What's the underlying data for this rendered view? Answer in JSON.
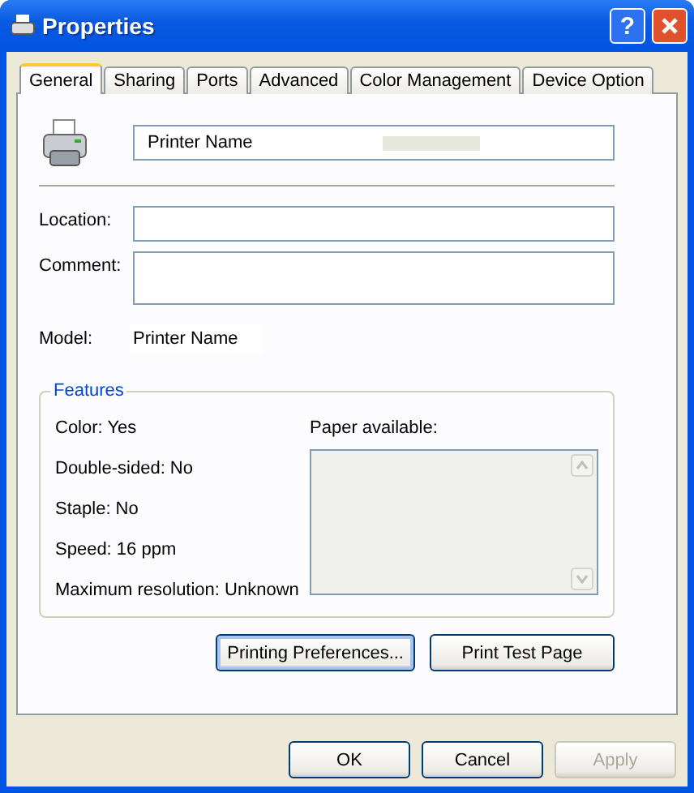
{
  "window": {
    "title": "Properties",
    "help_button": "?"
  },
  "tabs": [
    {
      "label": "General",
      "selected": true
    },
    {
      "label": "Sharing",
      "selected": false
    },
    {
      "label": "Ports",
      "selected": false
    },
    {
      "label": "Advanced",
      "selected": false
    },
    {
      "label": "Color Management",
      "selected": false
    },
    {
      "label": "Device Option",
      "selected": false
    }
  ],
  "printer_name": {
    "value": "Printer Name"
  },
  "fields": [
    {
      "label": "Location:",
      "multiline": false
    },
    {
      "label": "Comment:",
      "multiline": true
    }
  ],
  "model": {
    "label": "Model:",
    "value": "Printer Name"
  },
  "features": {
    "title": "Features",
    "items": [
      "Color: Yes",
      "Double-sided: No",
      "Staple: No",
      "Speed: 16 ppm",
      "Maximum resolution: Unknown"
    ],
    "paper_label": "Paper available:"
  },
  "panel_buttons": [
    {
      "label": "Printing Preferences...",
      "focused": true
    },
    {
      "label": "Print Test Page",
      "focused": false
    }
  ],
  "dialog_buttons": [
    {
      "label": "OK",
      "disabled": false
    },
    {
      "label": "Cancel",
      "disabled": false
    },
    {
      "label": "Apply",
      "disabled": true
    }
  ]
}
